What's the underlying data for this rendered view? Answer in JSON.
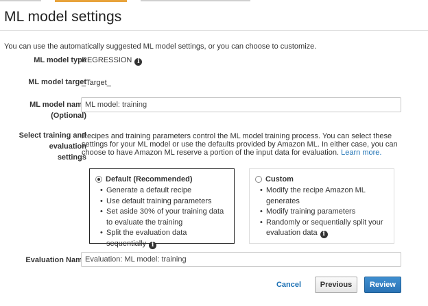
{
  "page": {
    "title": "ML model settings",
    "intro": "You can use the automatically suggested ML model settings, or you can choose to customize."
  },
  "fields": {
    "model_type_label": "ML model type",
    "model_type_value": "REGRESSION",
    "model_target_label": "ML model target",
    "model_target_value": "_Target_",
    "model_name_label": "ML model name",
    "model_name_label_note": "(Optional)",
    "model_name_value": "ML model: training",
    "training_label_line1": "Select training and",
    "training_label_line2": "evaluation",
    "training_label_line3": "settings",
    "training_description": "Recipes and training parameters control the ML model training process. You can select these settings for your ML model or use the defaults provided by Amazon ML. In either case, you can choose to have Amazon ML reserve a portion of the input data for evaluation.",
    "learn_more": "Learn more.",
    "evaluation_name_label": "Evaluation Name",
    "evaluation_name_value": "Evaluation: ML model: training"
  },
  "options": {
    "default": {
      "title": "Default (Recommended)",
      "selected": true,
      "bullets": [
        "Generate a default recipe",
        "Use default training parameters",
        "Set aside 30% of your training data to evaluate the training",
        "Split the evaluation data sequentially"
      ]
    },
    "custom": {
      "title": "Custom",
      "selected": false,
      "bullets": [
        "Modify the recipe Amazon ML generates",
        "Modify training parameters",
        "Randomly or sequentially split your evaluation data"
      ]
    }
  },
  "buttons": {
    "cancel": "Cancel",
    "previous": "Previous",
    "review": "Review"
  },
  "icons": {
    "info": "info-icon"
  },
  "colors": {
    "accent": "#e8a33b",
    "link": "#1a6fb3",
    "primary_button": "#2a73b5"
  }
}
